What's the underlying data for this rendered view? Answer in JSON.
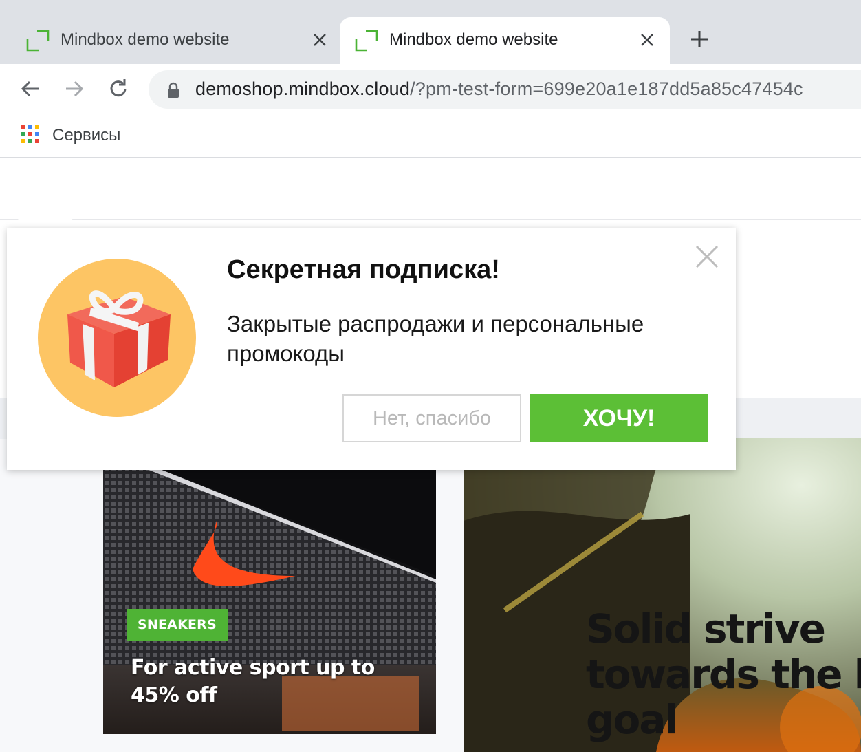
{
  "browser": {
    "tabs": [
      {
        "title": "Mindbox demo website",
        "active": false
      },
      {
        "title": "Mindbox demo website",
        "active": true
      }
    ],
    "address": {
      "host": "demoshop.mindbox.cloud",
      "path": "/?pm-test-form=699e20a1e187dd5a85c47454c"
    },
    "bookmarks": {
      "apps_label": "Сервисы"
    }
  },
  "popup": {
    "title": "Секретная подписка!",
    "description": "Закрытые распродажи и персональные промокоды",
    "decline_label": "Нет, спасибо",
    "accept_label": "ХОЧУ!",
    "accent_color": "#5cbf36",
    "icon": "gift-icon"
  },
  "page": {
    "promo_card": {
      "badge": "SNEAKERS",
      "text": "For active sport up to 45% off"
    },
    "hero_card": {
      "text": "Solid strive towards the h goal"
    }
  },
  "icons": {
    "favicon": "mindbox-favicon",
    "tab_close": "close-icon",
    "new_tab": "plus-icon",
    "back": "arrow-left-icon",
    "forward": "arrow-right-icon",
    "reload": "reload-icon",
    "lock": "lock-icon",
    "apps": "apps-grid-icon"
  }
}
